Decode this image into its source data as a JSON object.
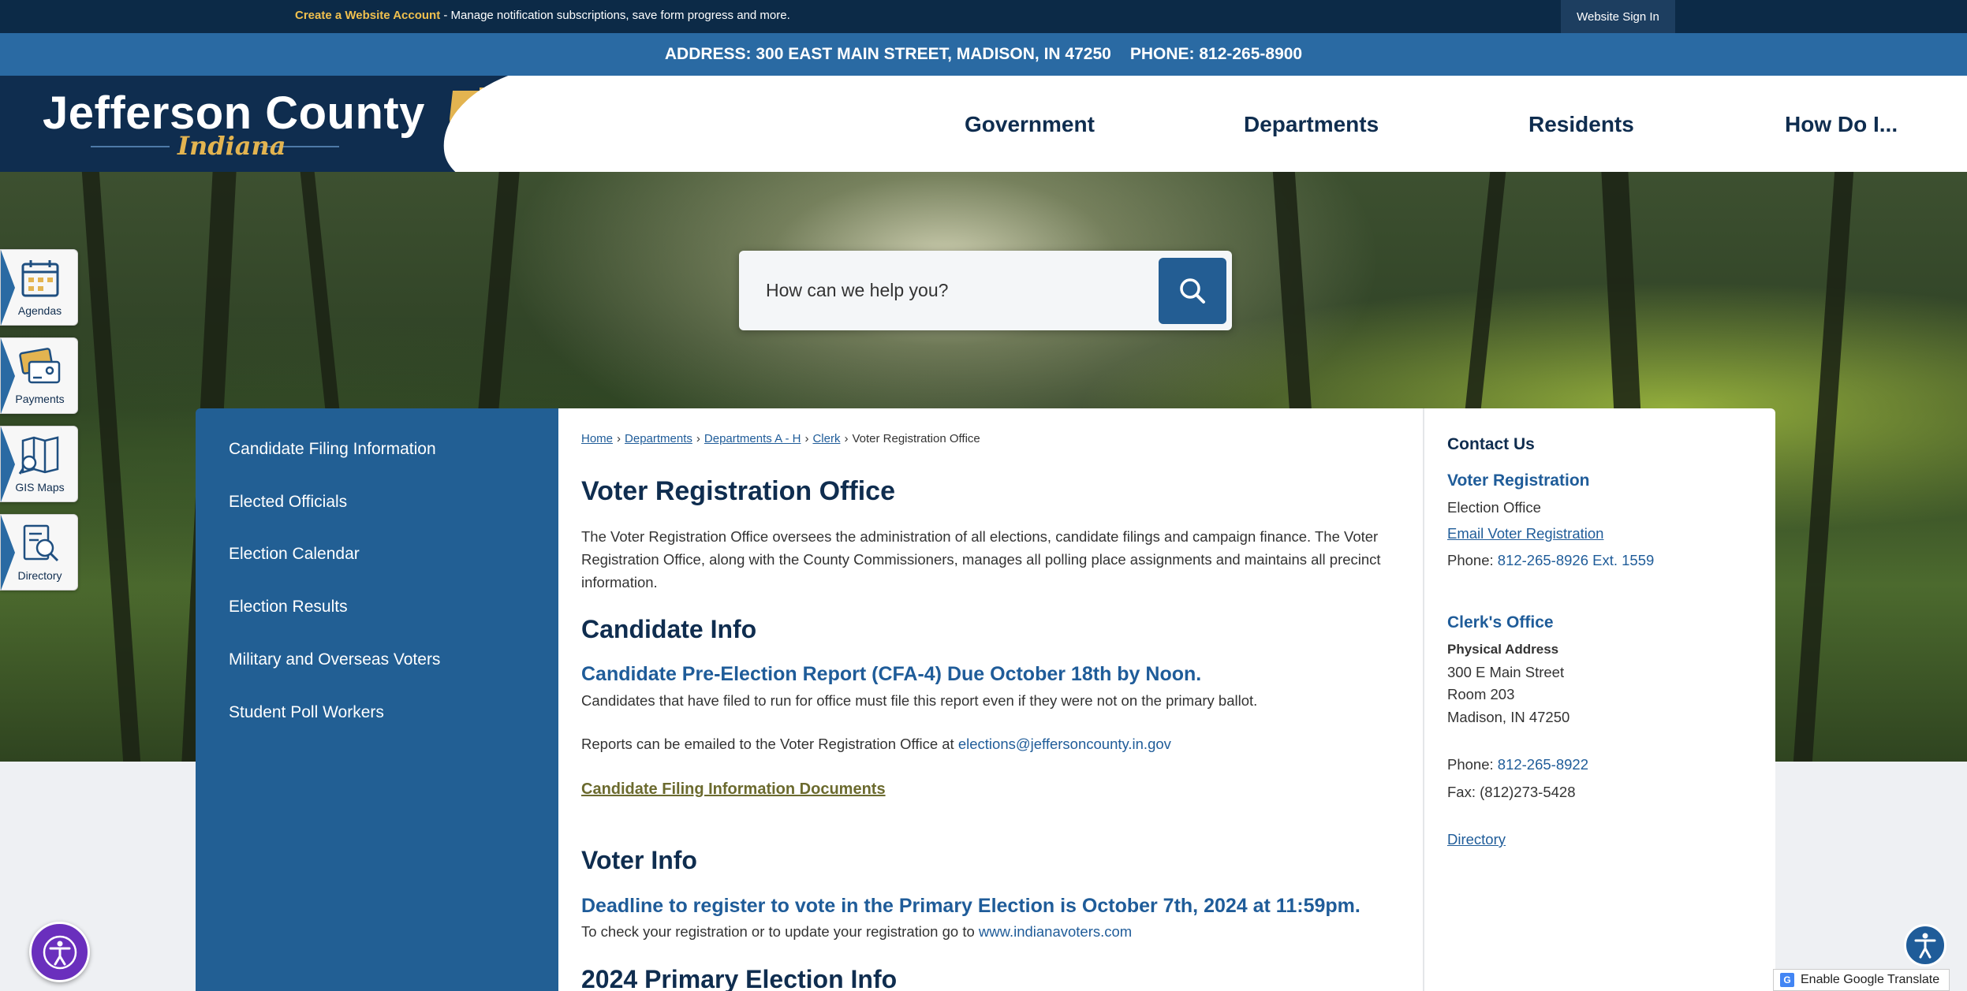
{
  "topbar": {
    "create_account": "Create a Website Account",
    "promo_rest": " - Manage notification subscriptions, save form progress and more.",
    "sign_in": "Website Sign In"
  },
  "address_bar": {
    "address": "ADDRESS: 300 EAST MAIN STREET, MADISON, IN 47250",
    "phone": "PHONE: 812-265-8900"
  },
  "logo": {
    "title": "Jefferson County",
    "subtitle": "Indiana"
  },
  "nav": [
    "Government",
    "Departments",
    "Residents",
    "How Do I..."
  ],
  "search": {
    "placeholder": "How can we help you?"
  },
  "quick_links": [
    "Agendas",
    "Payments",
    "GIS Maps",
    "Directory"
  ],
  "sidebar": [
    "Candidate Filing Information",
    "Elected Officials",
    "Election Calendar",
    "Election Results",
    "Military and Overseas Voters",
    "Student Poll Workers"
  ],
  "breadcrumb": [
    "Home",
    "Departments",
    "Departments A - H",
    "Clerk",
    "Voter Registration Office"
  ],
  "main": {
    "title": "Voter Registration Office",
    "intro": "The Voter Registration Office oversees the administration of all elections, candidate filings and campaign finance. The Voter Registration Office, along with the County Commissioners, manages all polling place assignments and maintains all precinct information.",
    "candidate_heading": "Candidate Info",
    "cfa_pre": "Candidate Pre-Election Report ",
    "cfa_link": "(CFA-4)",
    "cfa_post": " Due October 18th by Noon.",
    "cfa_body": "Candidates that have filed to run for office must file this report even if they were not on the primary ballot.",
    "reports_text": "Reports can be emailed to the Voter Registration Office at ",
    "reports_email": "elections@jeffersoncounty.in.gov",
    "filing_docs": "Candidate Filing Information Documents",
    "voter_heading": "Voter Info",
    "deadline": "Deadline to register to vote in the Primary Election is October 7th, 2024 at 11:59pm.",
    "check_text": "To check your registration or to update your registration go to ",
    "check_link": "www.indianavoters.com",
    "primary_heading": "2024 Primary Election Info"
  },
  "contact": {
    "heading": "Contact Us",
    "org1": "Voter Registration",
    "org1_sub": "Election Office",
    "org1_email": "Email Voter Registration",
    "org1_phone_label": "Phone: ",
    "org1_phone": "812-265-8926 Ext. 1559",
    "org2": "Clerk's Office",
    "addr_label": "Physical Address",
    "addr1": "300 E Main Street",
    "addr2": "Room 203",
    "addr3": "Madison, IN 47250",
    "org2_phone_label": "Phone: ",
    "org2_phone": "812-265-8922",
    "fax": "Fax: (812)273-5428",
    "directory": "Directory"
  },
  "translate": "Enable Google Translate",
  "colors": {
    "navy": "#0f2d4f",
    "blue": "#225f94",
    "gold": "#e3b450"
  }
}
